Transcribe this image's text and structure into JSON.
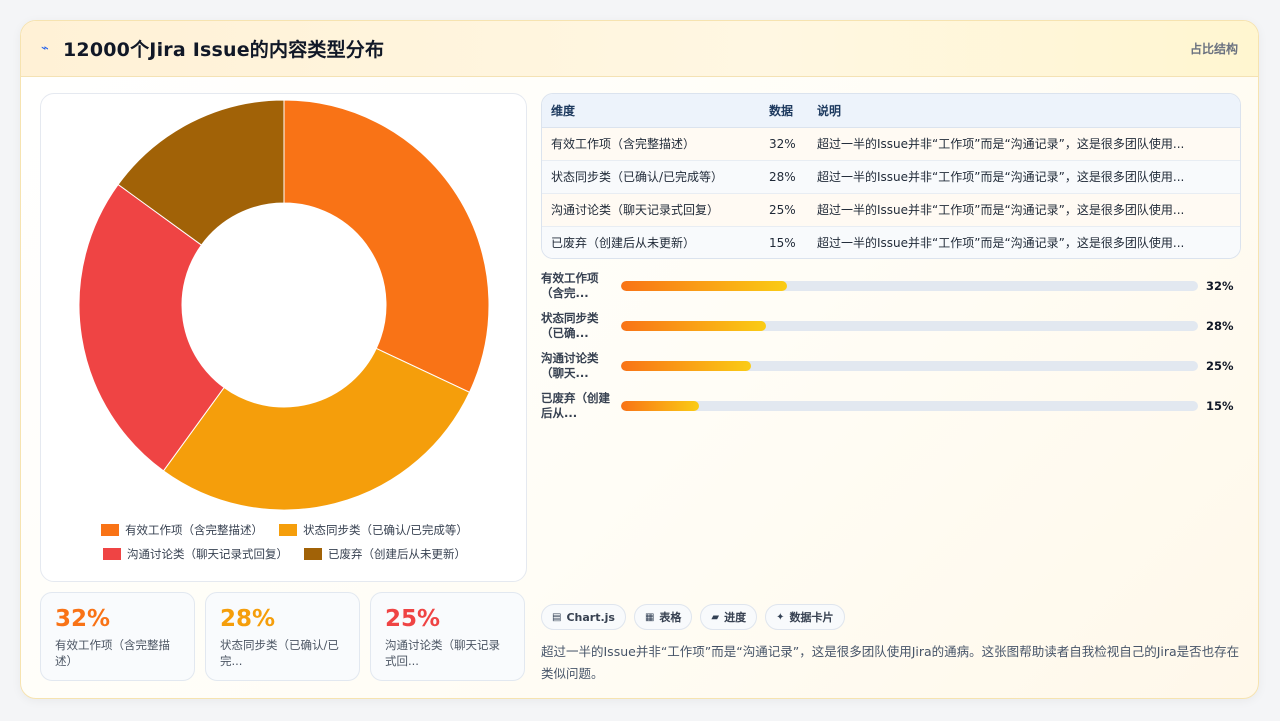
{
  "header": {
    "icon": "chart-icon",
    "title": "12000个Jira Issue的内容类型分布",
    "tag": "占比结构"
  },
  "legend": [
    {
      "label": "有效工作项（含完整描述）",
      "color": "#f97316"
    },
    {
      "label": "状态同步类（已确认/已完成等）",
      "color": "#f59e0b"
    },
    {
      "label": "沟通讨论类（聊天记录式回复）",
      "color": "#ef4444"
    },
    {
      "label": "已废弃（创建后从未更新）",
      "color": "#a16207"
    }
  ],
  "stats": [
    {
      "value": "32%",
      "label": "有效工作项（含完整描述）",
      "color": "#f97316"
    },
    {
      "value": "28%",
      "label": "状态同步类（已确认/已完...",
      "color": "#f59e0b"
    },
    {
      "value": "25%",
      "label": "沟通讨论类（聊天记录式回...",
      "color": "#ef4444"
    }
  ],
  "table": {
    "headers": [
      "维度",
      "数据",
      "说明"
    ],
    "rows": [
      [
        "有效工作项（含完整描述）",
        "32%",
        "超过一半的Issue并非“工作项”而是“沟通记录”，这是很多团队使用..."
      ],
      [
        "状态同步类（已确认/已完成等）",
        "28%",
        "超过一半的Issue并非“工作项”而是“沟通记录”，这是很多团队使用..."
      ],
      [
        "沟通讨论类（聊天记录式回复）",
        "25%",
        "超过一半的Issue并非“工作项”而是“沟通记录”，这是很多团队使用..."
      ],
      [
        "已废弃（创建后从未更新）",
        "15%",
        "超过一半的Issue并非“工作项”而是“沟通记录”，这是很多团队使用..."
      ]
    ]
  },
  "bars": [
    {
      "label": "有效工作项（含完...",
      "value": 32,
      "value_text": "32%"
    },
    {
      "label": "状态同步类（已确...",
      "value": 28,
      "value_text": "28%"
    },
    {
      "label": "沟通讨论类（聊天...",
      "value": 25,
      "value_text": "25%"
    },
    {
      "label": "已废弃（创建后从...",
      "value": 15,
      "value_text": "15%"
    }
  ],
  "chips": [
    {
      "icon": "chart-icon",
      "glyph": "▤",
      "label": "Chart.js"
    },
    {
      "icon": "table-icon",
      "glyph": "▦",
      "label": "表格"
    },
    {
      "icon": "progress-icon",
      "glyph": "▰",
      "label": "进度"
    },
    {
      "icon": "sparkle-icon",
      "glyph": "✦",
      "label": "数据卡片"
    }
  ],
  "summary": "超过一半的Issue并非“工作项”而是“沟通记录”，这是很多团队使用Jira的通病。这张图帮助读者自我检视自己的Jira是否也存在类似问题。",
  "chart_data": {
    "type": "pie",
    "donut": true,
    "categories": [
      "有效工作项（含完整描述）",
      "状态同步类（已确认/已完成等）",
      "沟通讨论类（聊天记录式回复）",
      "已废弃（创建后从未更新）"
    ],
    "values": [
      32,
      28,
      25,
      15
    ],
    "colors": [
      "#f97316",
      "#f59e0b",
      "#ef4444",
      "#a16207"
    ],
    "legend": "bottom"
  }
}
